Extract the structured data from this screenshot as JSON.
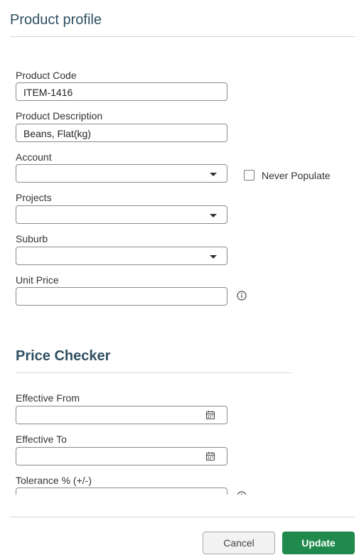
{
  "header": {
    "title": "Product profile"
  },
  "form": {
    "product_code": {
      "label": "Product Code",
      "value": "ITEM-1416"
    },
    "product_description": {
      "label": "Product Description",
      "value": "Beans, Flat(kg)"
    },
    "account": {
      "label": "Account",
      "value": ""
    },
    "never_populate": {
      "label": "Never Populate",
      "checked": false
    },
    "projects": {
      "label": "Projects",
      "value": ""
    },
    "suburb": {
      "label": "Suburb",
      "value": ""
    },
    "unit_price": {
      "label": "Unit Price",
      "value": ""
    }
  },
  "price_checker": {
    "title": "Price Checker",
    "effective_from": {
      "label": "Effective From",
      "value": ""
    },
    "effective_to": {
      "label": "Effective To",
      "value": ""
    },
    "tolerance": {
      "label": "Tolerance % (+/-)",
      "value": ""
    }
  },
  "footer": {
    "cancel_label": "Cancel",
    "update_label": "Update"
  },
  "colors": {
    "heading": "#2f4f63",
    "primary_button": "#1f8a4c",
    "border": "#8a8a8a"
  }
}
